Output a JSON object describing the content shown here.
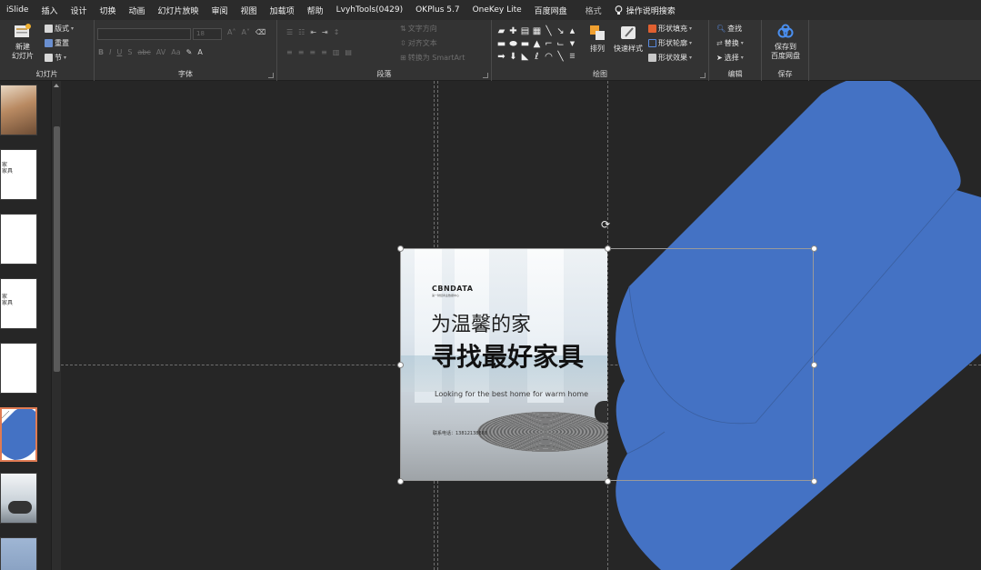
{
  "menu": {
    "tabs": [
      "iSlide",
      "插入",
      "设计",
      "切换",
      "动画",
      "幻灯片放映",
      "审阅",
      "视图",
      "加载项",
      "帮助",
      "LvyhTools(0429)",
      "OKPlus 5.7",
      "OneKey Lite",
      "百度网盘"
    ],
    "format_tab": "格式",
    "search_hint": "操作说明搜索"
  },
  "ribbon": {
    "slides": {
      "new_slide": "新建\n幻灯片",
      "layout": "版式",
      "reset": "重置",
      "section": "节",
      "label": "幻灯片"
    },
    "font": {
      "size": "18",
      "label": "字体"
    },
    "paragraph": {
      "text_direction": "文字方向",
      "align_text": "对齐文本",
      "convert_smartart": "转换为 SmartArt",
      "label": "段落"
    },
    "drawing": {
      "arrange": "排列",
      "quick_styles": "快速样式",
      "shape_fill": "形状填充",
      "shape_outline": "形状轮廓",
      "shape_effects": "形状效果",
      "label": "绘图"
    },
    "editing": {
      "find": "查找",
      "replace": "替换",
      "select": "选择",
      "label": "编辑"
    },
    "save": {
      "save_to_baidu": "保存到\n百度网盘",
      "label": "保存"
    }
  },
  "thumbnails": [
    {
      "type": "photo",
      "text": ""
    },
    {
      "type": "text",
      "text": "家\n家具"
    },
    {
      "type": "blank",
      "text": ""
    },
    {
      "type": "text",
      "text": "家\n家具"
    },
    {
      "type": "blank",
      "text": ""
    },
    {
      "type": "active-shape",
      "text": ""
    },
    {
      "type": "photo-chair",
      "text": ""
    },
    {
      "type": "photo-blue",
      "text": ""
    }
  ],
  "slide": {
    "brand": "CBNDATA",
    "brand_sub": "第一财经商业数据中心",
    "title_line1": "为温馨的家",
    "title_line2": "寻找最好家具",
    "subtitle_en": "Looking for the best home for warm home",
    "contact": "联系电话：13812138888"
  },
  "colors": {
    "shape_fill": "#4472c4",
    "active_thumb_border": "#e07b53"
  }
}
